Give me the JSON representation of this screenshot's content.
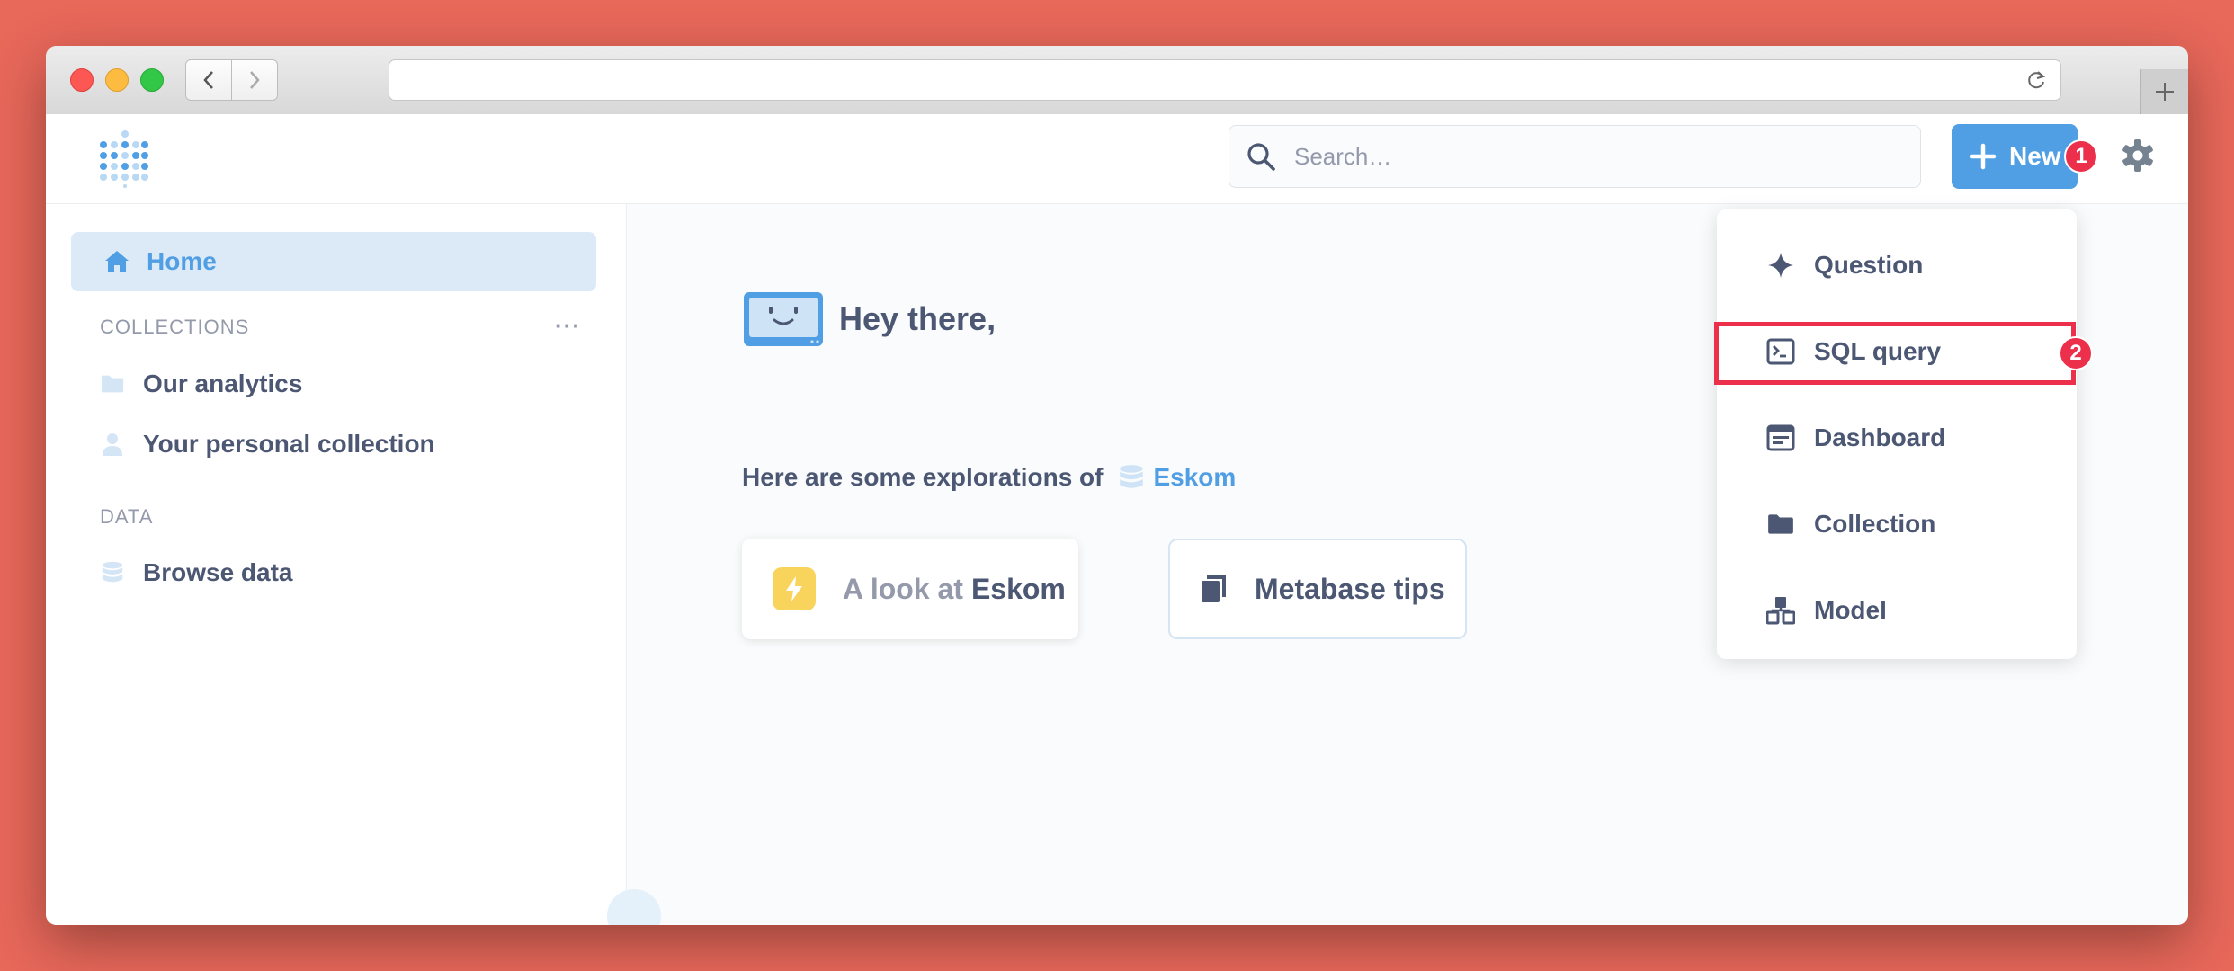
{
  "header": {
    "search_placeholder": "Search…",
    "new_button_label": "New",
    "step_badge_1": "1"
  },
  "sidebar": {
    "home_label": "Home",
    "collections_heading": "COLLECTIONS",
    "more_label": "···",
    "collections": [
      {
        "label": "Our analytics",
        "icon": "folder-icon"
      },
      {
        "label": "Your personal collection",
        "icon": "person-icon"
      }
    ],
    "data_heading": "DATA",
    "browse_data_label": "Browse data"
  },
  "main": {
    "greeting": "Hey there,",
    "explorations_text": "Here are some explorations of",
    "database_name": "Eskom",
    "cards": [
      {
        "prefix": "A look at",
        "label": "Eskom",
        "icon": "bolt-icon"
      },
      {
        "label": "Metabase tips",
        "icon": "book-icon"
      }
    ]
  },
  "new_menu": {
    "items": [
      {
        "label": "Question",
        "icon": "sparkle-icon"
      },
      {
        "label": "SQL query",
        "icon": "terminal-icon"
      },
      {
        "label": "Dashboard",
        "icon": "dashboard-icon"
      },
      {
        "label": "Collection",
        "icon": "folder-icon"
      },
      {
        "label": "Model",
        "icon": "model-icon"
      }
    ],
    "step_badge_2": "2"
  },
  "colors": {
    "brand": "#509ee3",
    "annotation": "#ec2f4b",
    "text": "#4c5773",
    "muted": "#949aab",
    "background": "#e8685a"
  }
}
